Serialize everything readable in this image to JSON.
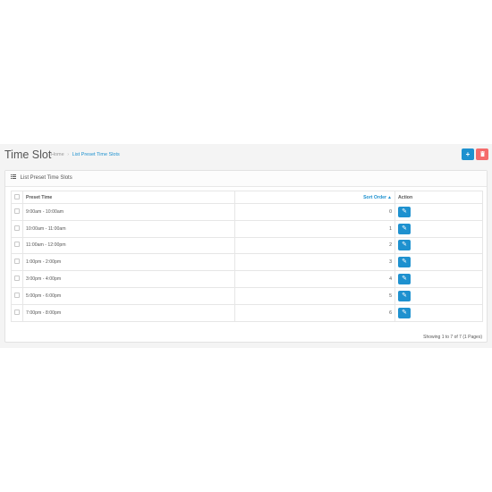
{
  "header": {
    "title": "Time Slot",
    "breadcrumb": [
      "Home",
      "List Preset Time Slots"
    ],
    "breadcrumb_sep": "›",
    "add_icon": "plus-icon",
    "delete_icon": "trash-icon",
    "add_symbol": "+",
    "delete_symbol": "🗑"
  },
  "panel": {
    "heading": "List Preset Time Slots",
    "heading_icon": "list-icon"
  },
  "table": {
    "columns": {
      "preset_time": "Preset Time",
      "sort_order": "Sort Order",
      "action": "Action"
    },
    "sort_indicator": "▲",
    "rows": [
      {
        "time": "9:00am - 10:00am",
        "sort": "0"
      },
      {
        "time": "10:00am - 11:00am",
        "sort": "1"
      },
      {
        "time": "11:00am - 12:00pm",
        "sort": "2"
      },
      {
        "time": "1:00pm - 2:00pm",
        "sort": "3"
      },
      {
        "time": "3:00pm - 4:00pm",
        "sort": "4"
      },
      {
        "time": "5:00pm - 6:00pm",
        "sort": "5"
      },
      {
        "time": "7:00pm - 8:00pm",
        "sort": "6"
      }
    ],
    "edit_icon": "pencil-icon",
    "edit_symbol": "✎"
  },
  "pagination": {
    "showing": "Showing 1 to 7 of 7 (1 Pages)"
  },
  "colors": {
    "primary": "#1e91cf",
    "danger": "#f56b6b",
    "page_bg": "#f4f4f4"
  }
}
